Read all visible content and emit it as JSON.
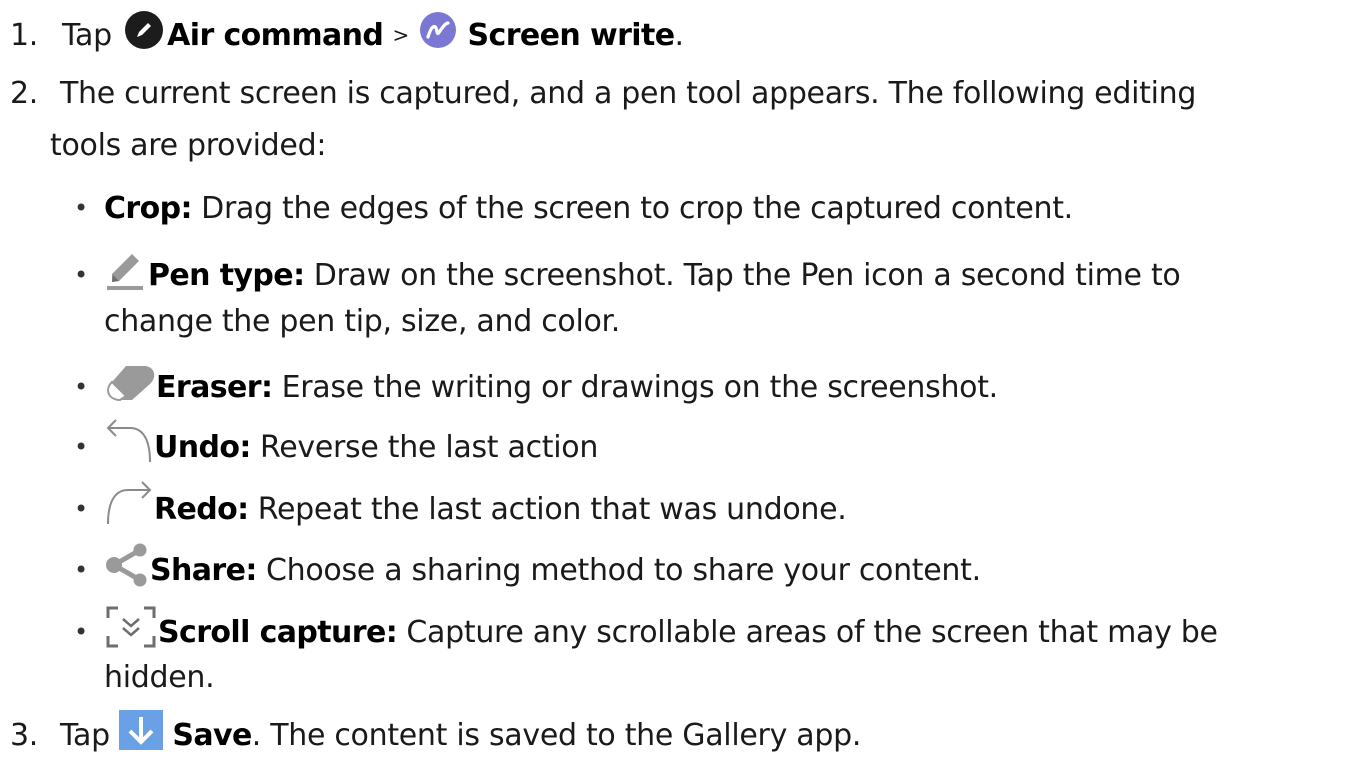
{
  "step1": {
    "number": "1.",
    "prefix": "Tap",
    "air_command": "Air command",
    "separator": ">",
    "screen_write": "Screen write",
    "period": "."
  },
  "step2": {
    "number": "2.",
    "text_line1": "The current screen is captured, and a pen tool appears. The following editing",
    "text_line2": "tools are provided:",
    "tools": [
      {
        "name": "Crop",
        "icon": "none",
        "colon": ":",
        "desc": " Drag the edges of the screen to crop the captured content."
      },
      {
        "name": "Pen type",
        "icon": "pen-icon",
        "colon": ":",
        "desc": " Draw on the screenshot. Tap the Pen icon a second time to",
        "desc_line2": "change the pen tip, size, and color."
      },
      {
        "name": "Eraser",
        "icon": "eraser-icon",
        "colon": ":",
        "desc": " Erase the writing or drawings on the screenshot."
      },
      {
        "name": "Undo",
        "icon": "undo-icon",
        "colon": ":",
        "desc": " Reverse the last action"
      },
      {
        "name": "Redo",
        "icon": "redo-icon",
        "colon": ":",
        "desc": " Repeat the last action that was undone."
      },
      {
        "name": "Share",
        "icon": "share-icon",
        "colon": ":",
        "desc": " Choose a sharing method to share your content."
      },
      {
        "name": "Scroll capture",
        "icon": "scroll-capture-icon",
        "colon": ":",
        "desc": " Capture any scrollable areas of the screen that may be",
        "desc_line2": "hidden."
      }
    ]
  },
  "step3": {
    "number": "3.",
    "prefix": "Tap",
    "save": "Save",
    "rest": ". The content is saved to the Gallery app."
  },
  "colors": {
    "text": "#1a1a1a",
    "air_command_icon": "#1c1c1c",
    "screen_write_icon": "#7b78d4",
    "save_icon": "#6aa0e6",
    "icon_gray": "#8a8a8a"
  }
}
